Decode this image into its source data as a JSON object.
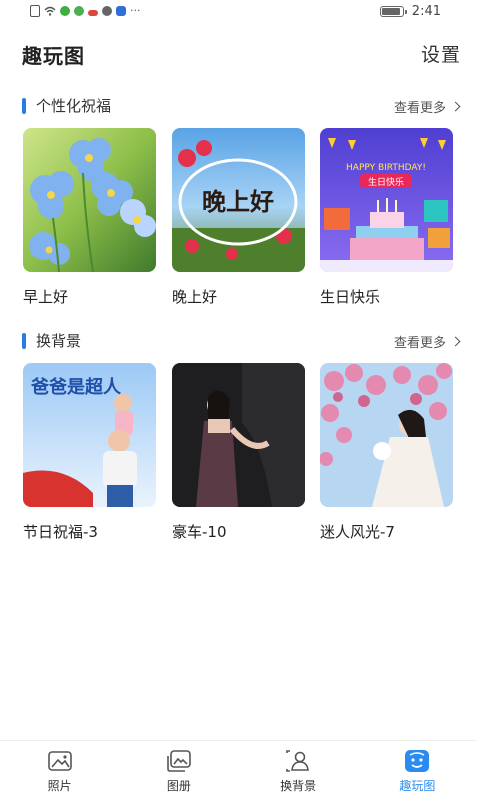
{
  "status_bar": {
    "time": "2:41",
    "more_indicator": "···"
  },
  "header": {
    "title": "趣玩图",
    "settings_label": "设置"
  },
  "sections": [
    {
      "title": "个性化祝福",
      "more_label": "查看更多",
      "cards": [
        {
          "label": "早上好",
          "image": "blue-flowers"
        },
        {
          "label": "晚上好",
          "image": "evening-greeting",
          "overlay_text": "晚上好"
        },
        {
          "label": "生日快乐",
          "image": "birthday-cake",
          "overlay_text": "HAPPY BIRTHDAY!",
          "overlay_text_2": "生日快乐"
        }
      ]
    },
    {
      "title": "换背景",
      "more_label": "查看更多",
      "cards": [
        {
          "label": "节日祝福-3",
          "image": "father-child",
          "overlay_text": "爸爸是超人"
        },
        {
          "label": "豪车-10",
          "image": "woman-dark"
        },
        {
          "label": "迷人风光-7",
          "image": "woman-blossoms"
        }
      ]
    }
  ],
  "tabbar": [
    {
      "label": "照片",
      "icon": "photo-icon",
      "active": false
    },
    {
      "label": "图册",
      "icon": "album-icon",
      "active": false
    },
    {
      "label": "换背景",
      "icon": "change-background-icon",
      "active": false
    },
    {
      "label": "趣玩图",
      "icon": "fun-image-icon",
      "active": true
    }
  ],
  "colors": {
    "accent": "#2a7be4",
    "active_tab": "#2a8cf0"
  }
}
